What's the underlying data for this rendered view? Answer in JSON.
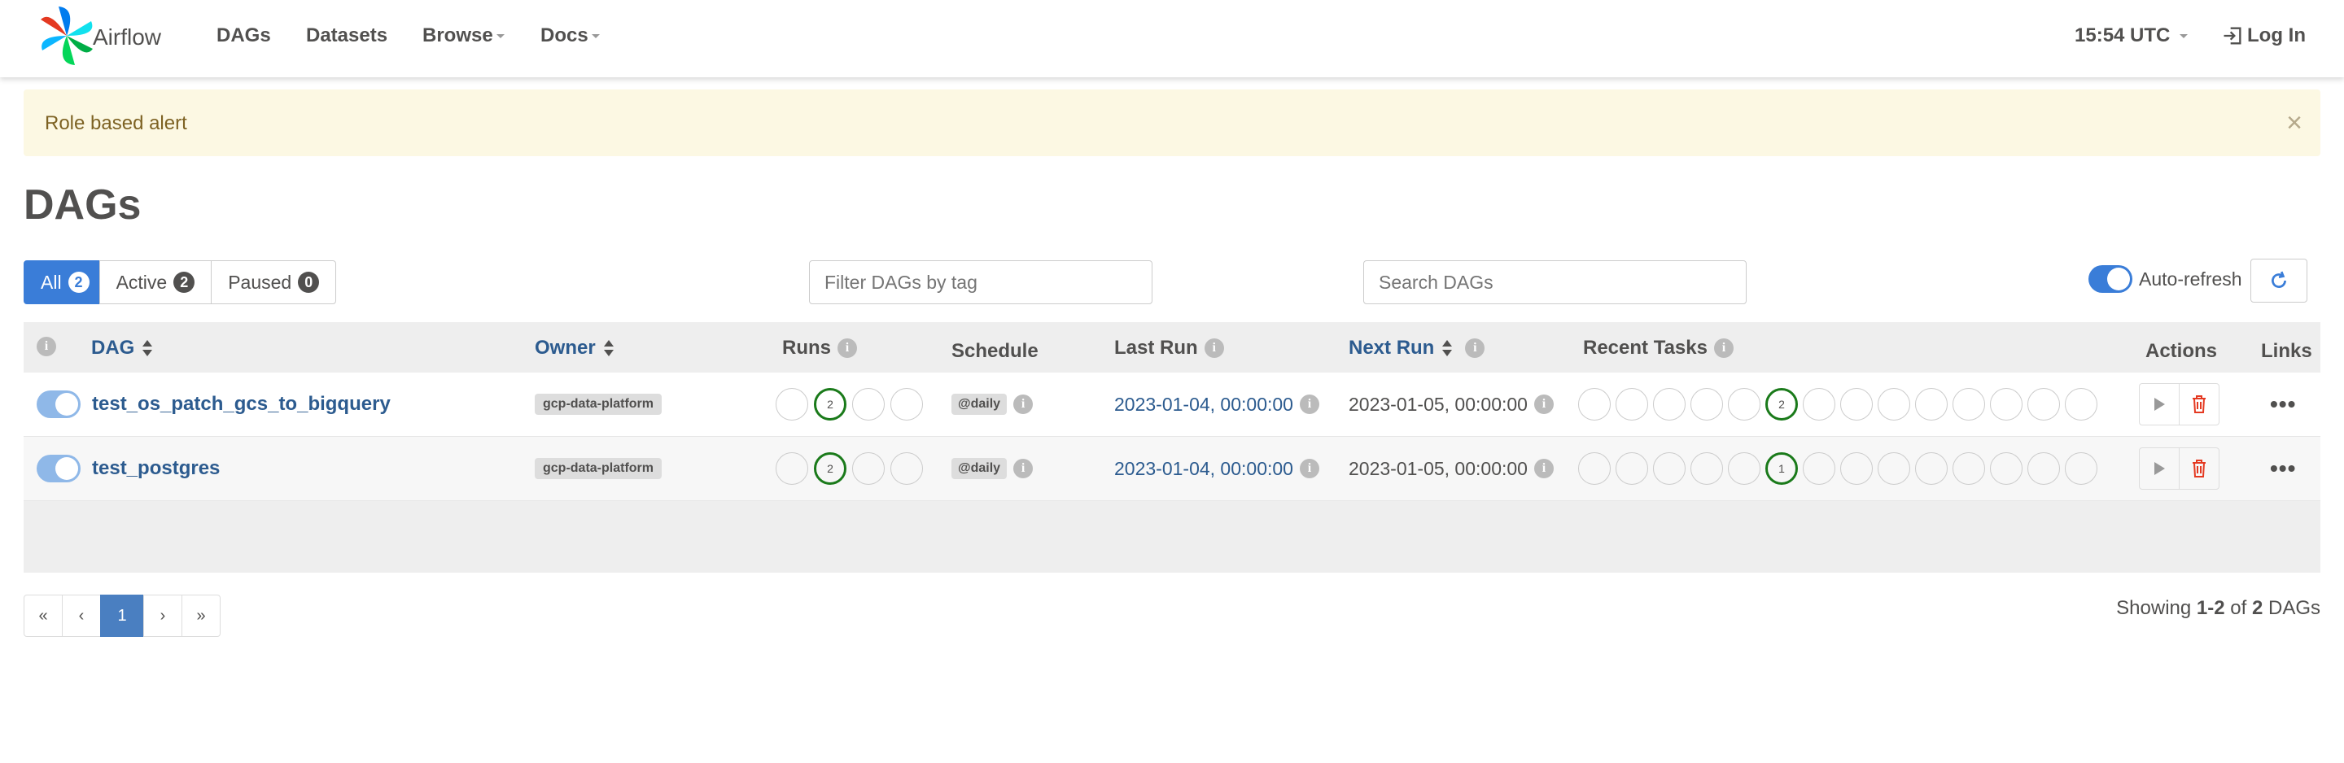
{
  "navbar": {
    "brand": "Airflow",
    "items": [
      {
        "label": "DAGs",
        "dropdown": false
      },
      {
        "label": "Datasets",
        "dropdown": false
      },
      {
        "label": "Browse",
        "dropdown": true
      },
      {
        "label": "Docs",
        "dropdown": true
      }
    ],
    "time": "15:54 UTC",
    "login": "Log In"
  },
  "alert": {
    "text": "Role based alert",
    "close": "×"
  },
  "page_title": "DAGs",
  "filters": {
    "all": {
      "label": "All",
      "count": "2"
    },
    "active": {
      "label": "Active",
      "count": "2"
    },
    "paused": {
      "label": "Paused",
      "count": "0"
    }
  },
  "tag_filter": {
    "placeholder": "Filter DAGs by tag"
  },
  "search": {
    "placeholder": "Search DAGs"
  },
  "auto_refresh": {
    "label": "Auto-refresh",
    "enabled": true
  },
  "table": {
    "headers": {
      "dag": "DAG",
      "owner": "Owner",
      "runs": "Runs",
      "schedule": "Schedule",
      "last_run": "Last Run",
      "next_run": "Next Run",
      "recent_tasks": "Recent Tasks",
      "actions": "Actions",
      "links": "Links"
    },
    "rows": [
      {
        "paused": false,
        "dag_id": "test_os_patch_gcs_to_bigquery",
        "owner": "gcp-data-platform",
        "runs": [
          "",
          "2",
          "",
          ""
        ],
        "schedule": "@daily",
        "last_run": "2023-01-04, 00:00:00",
        "next_run": "2023-01-05, 00:00:00",
        "recent_tasks": [
          "",
          "",
          "",
          "",
          "",
          "2",
          "",
          "",
          "",
          "",
          "",
          "",
          "",
          ""
        ]
      },
      {
        "paused": false,
        "dag_id": "test_postgres",
        "owner": "gcp-data-platform",
        "runs": [
          "",
          "2",
          "",
          ""
        ],
        "schedule": "@daily",
        "last_run": "2023-01-04, 00:00:00",
        "next_run": "2023-01-05, 00:00:00",
        "recent_tasks": [
          "",
          "",
          "",
          "",
          "",
          "1",
          "",
          "",
          "",
          "",
          "",
          "",
          "",
          ""
        ]
      }
    ]
  },
  "pagination": {
    "first": "«",
    "prev": "‹",
    "current": "1",
    "next": "›",
    "last": "»"
  },
  "showing": {
    "prefix": "Showing",
    "range": "1-2",
    "of": "of",
    "total": "2",
    "suffix": "DAGs"
  },
  "colors": {
    "accent": "#3a7dd8",
    "success": "#1a7a1a",
    "alert_bg": "#fcf8e3",
    "link": "#2c5b8f"
  }
}
